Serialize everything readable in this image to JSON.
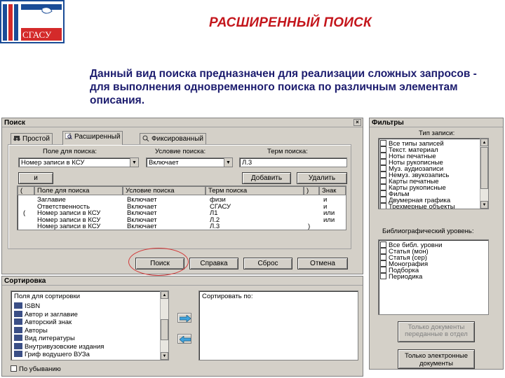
{
  "slide": {
    "title": "РАСШИРЕННЫЙ ПОИСК",
    "description": "Данный вид поиска предназначен для реализации сложных запросов - для выполнения одновременного поиска по различным элементам описания.",
    "logo_text": "СГАСУ"
  },
  "search_window": {
    "title": "Поиск",
    "tabs": [
      {
        "label": "Простой"
      },
      {
        "label": "Расширенный"
      },
      {
        "label": "Фиксированный"
      }
    ],
    "field_label": "Поле для поиска:",
    "condition_label": "Условие поиска:",
    "term_label": "Терм поиска:",
    "field_value": "Номер записи в КСУ",
    "condition_value": "Включает",
    "term_value": "Л.3",
    "logic_value": "и",
    "add_button": "Добавить",
    "delete_button": "Удалить",
    "table_headers": [
      "(",
      "Поле для поиска",
      "Условие поиска",
      "Терм поиска",
      ")",
      "Знак"
    ],
    "table_rows": [
      {
        "open": "",
        "field": "Заглавие",
        "condition": "Включает",
        "term": "физи",
        "close": "",
        "op": "и"
      },
      {
        "open": "",
        "field": "Ответственность",
        "condition": "Включает",
        "term": "СГАСУ",
        "close": "",
        "op": "и"
      },
      {
        "open": "(",
        "field": "Номер записи в КСУ",
        "condition": "Включает",
        "term": "Л1",
        "close": "",
        "op": "или"
      },
      {
        "open": "",
        "field": "Номер записи в КСУ",
        "condition": "Включает",
        "term": "Л.2",
        "close": "",
        "op": "или"
      },
      {
        "open": "",
        "field": "Номер записи в КСУ",
        "condition": "Включает",
        "term": "Л.3",
        "close": ")",
        "op": ""
      }
    ],
    "buttons": {
      "search": "Поиск",
      "help": "Справка",
      "reset": "Сброс",
      "cancel": "Отмена"
    }
  },
  "filters_window": {
    "title": "Фильтры",
    "record_types_label": "Тип записи:",
    "record_types": [
      "Все типы записей",
      "Текст. материал",
      "Ноты печатные",
      "Ноты рукописные",
      "Муз. аудиозаписи",
      "Немуз. звукозапись",
      "Карты печатные",
      "Карты рукописные",
      "Фильм",
      "Двумерная графика",
      "Трехмерные объекты"
    ],
    "bib_levels_label": "Библиографический уровень:",
    "bib_levels": [
      "Все библ. уровни",
      "Статья (мон)",
      "Статья (сер)",
      "Монография",
      "Подборка",
      "Периодика"
    ],
    "docs_in_stock_button": "Только документы переданные в отдел",
    "electronic_only_button": "Только электронные документы"
  },
  "sort_window": {
    "title": "Сортировка",
    "fields_label": "Поля для сортировки",
    "sort_by_label": "Сортировать по:",
    "fields": [
      "ISBN",
      "Автор и заглавие",
      "Авторский знак",
      "Авторы",
      "Вид литературы",
      "Внутривузовские издания",
      "Гриф водушего ВУЗа"
    ],
    "descending_label": "По убыванию"
  }
}
